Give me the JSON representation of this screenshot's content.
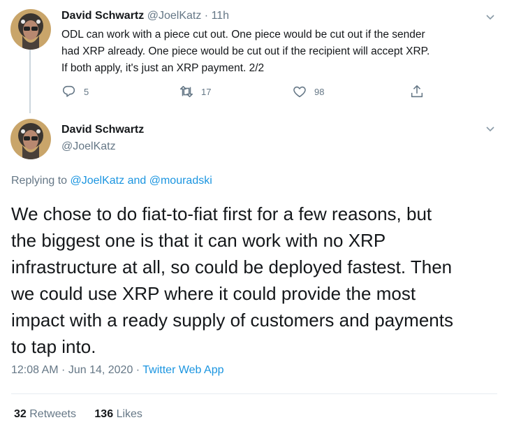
{
  "tweet1": {
    "name": "David Schwartz",
    "handle": "@JoelKatz",
    "sep": "·",
    "time": "11h",
    "text_lines": [
      "ODL can work with a piece cut out. One piece would be cut out if the sender",
      "had XRP already. One piece would be cut out if the recipient will accept XRP.",
      "If both apply, it's just an XRP payment. 2/2"
    ],
    "actions": {
      "reply_count": "5",
      "retweet_count": "17",
      "like_count": "98"
    }
  },
  "tweet2": {
    "name": "David Schwartz",
    "handle": "@JoelKatz",
    "replying_prefix": "Replying to",
    "replying_user1": "@JoelKatz",
    "replying_and": "and",
    "replying_user2": "@mouradski",
    "text_lines": [
      "We chose to do fiat-to-fiat first for a few reasons, but",
      "the biggest one is that it can work with no XRP",
      "infrastructure at all, so could be deployed fastest. Then",
      "we could use XRP where it could provide the most",
      "impact with a ready supply of customers and payments",
      "to tap into."
    ],
    "timestamp": "12:08 AM · Jun 14, 2020",
    "meta_sep": "·",
    "source": "Twitter Web App",
    "retweets_count": "32",
    "retweets_label": "Retweets",
    "likes_count": "136",
    "likes_label": "Likes"
  },
  "colors": {
    "link": "#1b95e0",
    "secondary": "#657786",
    "primary": "#14171a"
  },
  "icons": [
    "avatar",
    "chevron-down-icon",
    "reply-icon",
    "retweet-icon",
    "like-icon",
    "share-icon"
  ]
}
